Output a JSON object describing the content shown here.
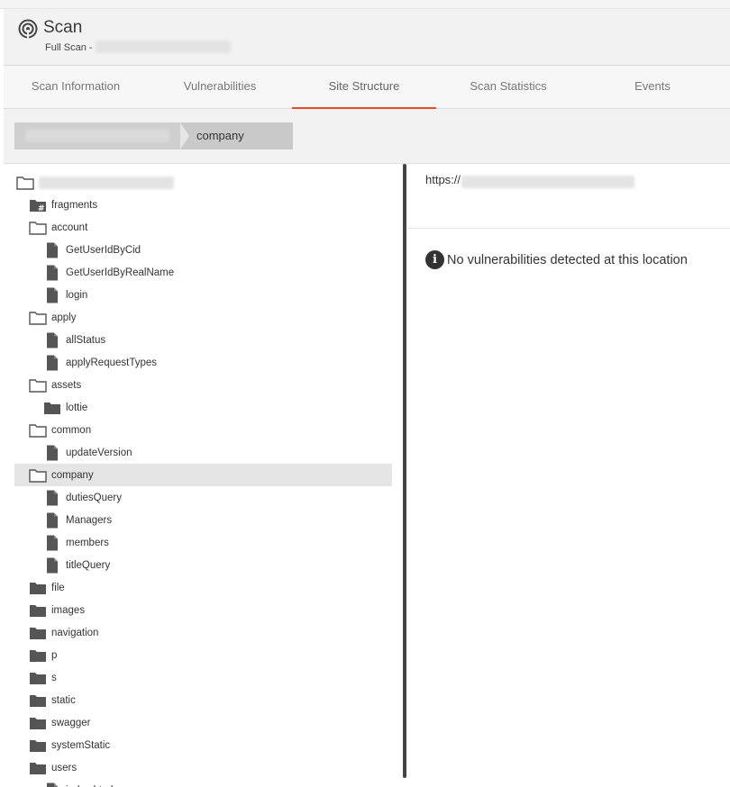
{
  "header": {
    "title": "Scan",
    "subtitle_prefix": "Full Scan -"
  },
  "tabs": [
    {
      "label": "Scan Information"
    },
    {
      "label": "Vulnerabilities"
    },
    {
      "label": "Site Structure"
    },
    {
      "label": "Scan Statistics"
    },
    {
      "label": "Events"
    }
  ],
  "active_tab": "Site Structure",
  "breadcrumb": {
    "current": "company"
  },
  "tree": {
    "items": [
      {
        "label": "",
        "icon": "folder-open-icon"
      },
      {
        "label": "fragments",
        "icon": "hash-folder-icon"
      },
      {
        "label": "account",
        "icon": "folder-open-icon"
      },
      {
        "label": "GetUserIdByCid",
        "icon": "file-icon"
      },
      {
        "label": "GetUserIdByRealName",
        "icon": "file-icon"
      },
      {
        "label": "login",
        "icon": "file-icon"
      },
      {
        "label": "apply",
        "icon": "folder-open-icon"
      },
      {
        "label": "allStatus",
        "icon": "file-icon"
      },
      {
        "label": "applyRequestTypes",
        "icon": "file-icon"
      },
      {
        "label": "assets",
        "icon": "folder-open-icon"
      },
      {
        "label": "lottie",
        "icon": "folder-filled-icon"
      },
      {
        "label": "common",
        "icon": "folder-open-icon"
      },
      {
        "label": "updateVersion",
        "icon": "file-icon"
      },
      {
        "label": "company",
        "icon": "folder-open-icon"
      },
      {
        "label": "dutiesQuery",
        "icon": "file-icon"
      },
      {
        "label": "Managers",
        "icon": "file-icon"
      },
      {
        "label": "members",
        "icon": "file-icon"
      },
      {
        "label": "titleQuery",
        "icon": "file-icon"
      },
      {
        "label": "file",
        "icon": "folder-filled-icon"
      },
      {
        "label": "images",
        "icon": "folder-filled-icon"
      },
      {
        "label": "navigation",
        "icon": "folder-filled-icon"
      },
      {
        "label": "p",
        "icon": "folder-filled-icon"
      },
      {
        "label": "s",
        "icon": "folder-filled-icon"
      },
      {
        "label": "static",
        "icon": "folder-filled-icon"
      },
      {
        "label": "swagger",
        "icon": "folder-filled-icon"
      },
      {
        "label": "systemStatic",
        "icon": "folder-filled-icon"
      },
      {
        "label": "users",
        "icon": "folder-filled-icon"
      },
      {
        "label": "index.html",
        "icon": "file-icon"
      }
    ],
    "selected_item": "company"
  },
  "detail": {
    "url_prefix": "https://",
    "message": "No vulnerabilities detected at this location"
  },
  "colors": {
    "accent": "#e8482b",
    "selected_row": "#e5e5e5",
    "icon": "#555555"
  }
}
